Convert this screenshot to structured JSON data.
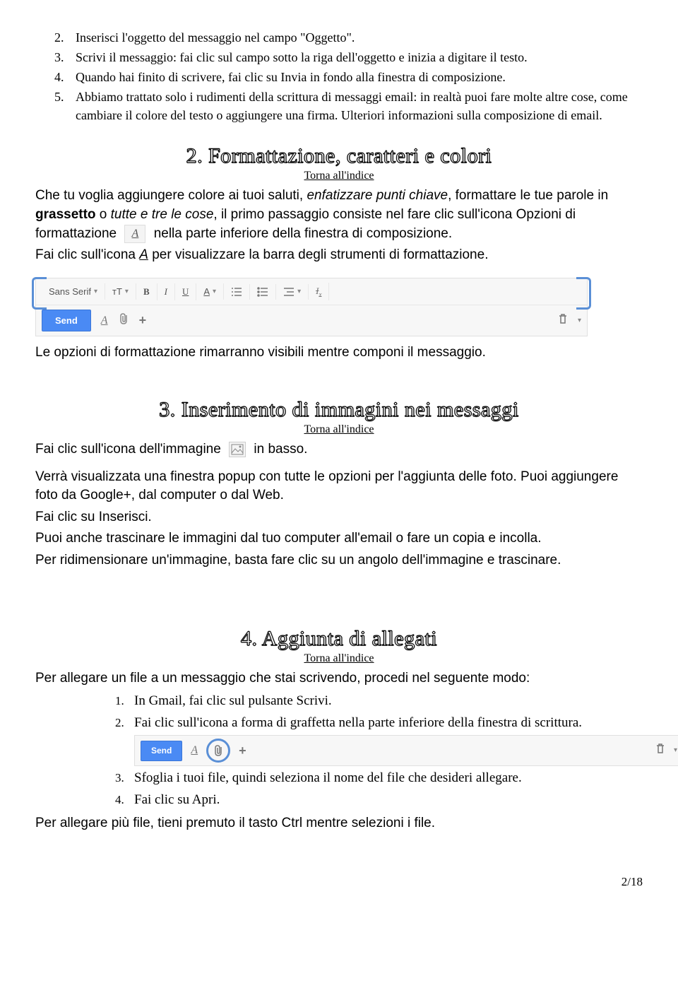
{
  "list1": {
    "item2": "Inserisci l'oggetto del messaggio nel campo \"Oggetto\".",
    "item3": "Scrivi il messaggio: fai clic sul campo sotto la riga dell'oggetto e inizia a digitare il testo.",
    "item4": "Quando hai finito di scrivere, fai clic su Invia in fondo alla finestra di composizione.",
    "item5a": "Abbiamo trattato solo i rudimenti della scrittura di messaggi email: in realtà puoi fare molte altre cose, come",
    "item5b": "cambiare il colore del testo o aggiungere una firma. Ulteriori informazioni sulla composizione di email."
  },
  "section2": {
    "title": "2. Formattazione, caratteri e colori",
    "index": "Torna all'indice",
    "p1a": "Che tu voglia aggiungere colore ai tuoi saluti, ",
    "p1b": "enfatizzare punti chiave",
    "p1c": ", formattare le tue parole in ",
    "p1d": "grassetto",
    "p1e": " o ",
    "p1f": "tutte e tre le cose",
    "p1g": ", il primo passaggio consiste nel fare clic sull'icona Opzioni di formattazione",
    "p1h": "nella parte inferiore della finestra di composizione.",
    "p2a": "Fai clic sull'icona ",
    "p2b": "A",
    "p2c": " per visualizzare la barra degli strumenti di formattazione.",
    "after": "Le opzioni di formattazione rimarranno visibili mentre componi il messaggio."
  },
  "toolbar": {
    "font": "Sans Serif",
    "send": "Send",
    "b": "B",
    "i": "I",
    "u": "U",
    "a": "A",
    "plus": "+",
    "tt": "тT"
  },
  "section3": {
    "title": "3. Inserimento di immagini nei messaggi",
    "index": "Torna all'indice",
    "p1a": "Fai clic sull'icona dell'immagine",
    "p1b": "in basso.",
    "p2": "Verrà visualizzata una finestra popup con tutte le opzioni per l'aggiunta delle foto. Puoi aggiungere foto da Google+, dal computer o dal Web.",
    "p3": "Fai clic su Inserisci.",
    "p4": "Puoi anche trascinare le immagini dal tuo computer all'email o fare un copia e incolla.",
    "p5": "Per ridimensionare un'immagine, basta fare clic su un angolo dell'immagine e trascinare."
  },
  "section4": {
    "title": "4. Aggiunta di allegati",
    "index": "Torna all'indice",
    "intro": "Per allegare un file a un messaggio che stai scrivendo, procedi nel seguente modo:",
    "li1": "In Gmail, fai clic sul pulsante Scrivi.",
    "li2": "Fai clic sull'icona a forma di graffetta nella parte inferiore della finestra di scrittura.",
    "li3": "Sfoglia i tuoi file, quindi seleziona il nome del file che desideri allegare.",
    "li4": "Fai clic su Apri.",
    "outro": "Per allegare più file, tieni premuto il tasto Ctrl  mentre selezioni i file."
  },
  "page": "2/18"
}
